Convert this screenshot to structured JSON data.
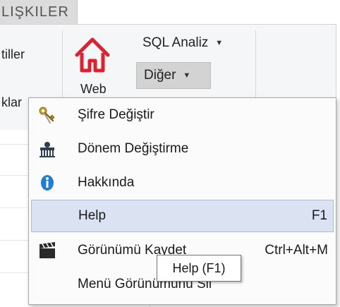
{
  "ribbon": {
    "active_tab": "LIŞKILER",
    "left_group": {
      "item1": "tiller",
      "item2": "klar"
    },
    "web_button": {
      "icon": "home-icon",
      "label": "Web"
    },
    "sql_button": {
      "label": "SQL Analiz",
      "caret": "▼"
    },
    "diger_button": {
      "label": "Diğer",
      "caret": "▼"
    }
  },
  "menu": {
    "items": [
      {
        "label": "Şifre Değiştir",
        "icon": "keys-icon",
        "shortcut": ""
      },
      {
        "label": "Dönem Değiştirme",
        "icon": "period-icon",
        "shortcut": ""
      },
      {
        "label": "Hakkında",
        "icon": "info-icon",
        "shortcut": ""
      },
      {
        "label": "Help",
        "icon": "",
        "shortcut": "F1"
      },
      {
        "label": "Görünümü Kaydet",
        "icon": "clapperboard-icon",
        "shortcut": "Ctrl+Alt+M"
      },
      {
        "label": "Menü Görünümünü Sil",
        "icon": "",
        "shortcut": ""
      }
    ],
    "highlighted_index": 3
  },
  "tooltip": {
    "text": "Help (F1)"
  },
  "colors": {
    "accent_red": "#e0202e",
    "hover_bg": "#dbe3f3",
    "info_blue": "#1e7fd6"
  }
}
